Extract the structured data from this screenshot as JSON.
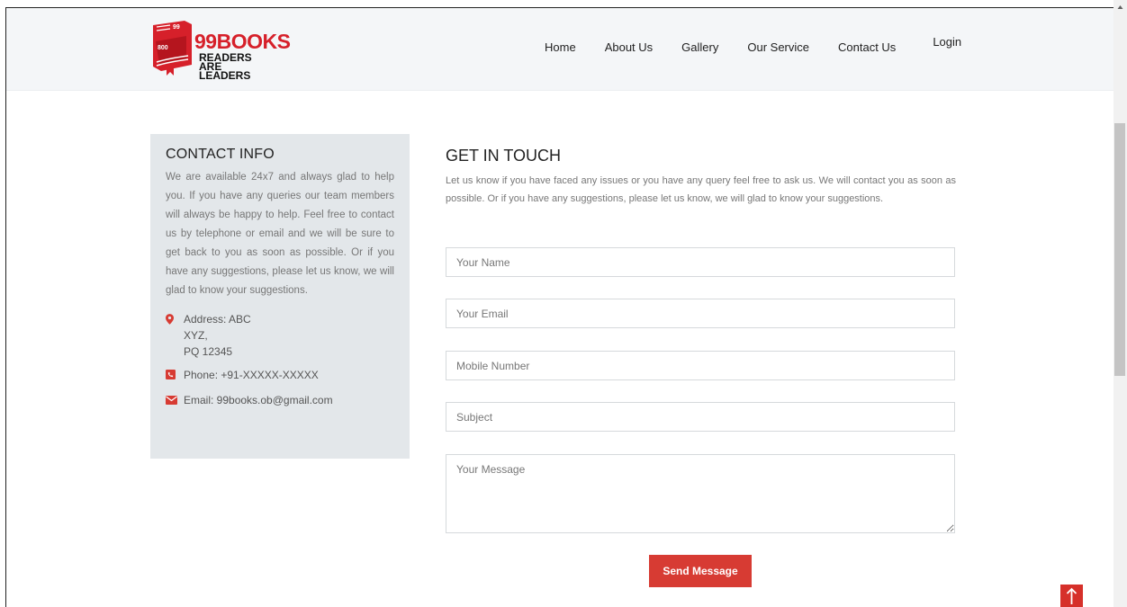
{
  "header": {
    "logo": {
      "badge_top": "99",
      "badge_bottom": "800",
      "brand": "99BOOKS",
      "tagline_line1": "READERS ARE",
      "tagline_line2": "LEADERS"
    },
    "nav": [
      {
        "label": "Home"
      },
      {
        "label": "About Us"
      },
      {
        "label": "Gallery"
      },
      {
        "label": "Our Service"
      },
      {
        "label": "Contact Us"
      },
      {
        "label": "Login"
      }
    ]
  },
  "contact_info": {
    "title": "CONTACT INFO",
    "description": "We are available 24x7 and always glad to help you. If you have any queries our team members will always be happy to help. Feel free to contact us by telephone or email and we will be sure to get back to you as soon as possible. Or if you have any suggestions, please let us know, we will glad to know your suggestions.",
    "address_line1": "Address: ABC",
    "address_line2": "XYZ,",
    "address_line3": "PQ 12345",
    "phone": "Phone: +91-XXXXX-XXXXX",
    "email": "Email: 99books.ob@gmail.com"
  },
  "form": {
    "title": "GET IN TOUCH",
    "description": "Let us know if you have faced any issues or you have any query feel free to ask us. We will contact you as soon as possible. Or if you have any suggestions, please let us know, we will glad to know your suggestions.",
    "name_placeholder": "Your Name",
    "email_placeholder": "Your Email",
    "mobile_placeholder": "Mobile Number",
    "subject_placeholder": "Subject",
    "message_placeholder": "Your Message",
    "submit_label": "Send Message"
  },
  "colors": {
    "accent": "#d73b33",
    "header_bg": "#f4f6f8",
    "info_bg": "#e3e7ea"
  },
  "icons": {
    "address": "map-marker-icon",
    "phone": "phone-icon",
    "email": "envelope-icon",
    "to_top": "arrow-up-icon"
  }
}
